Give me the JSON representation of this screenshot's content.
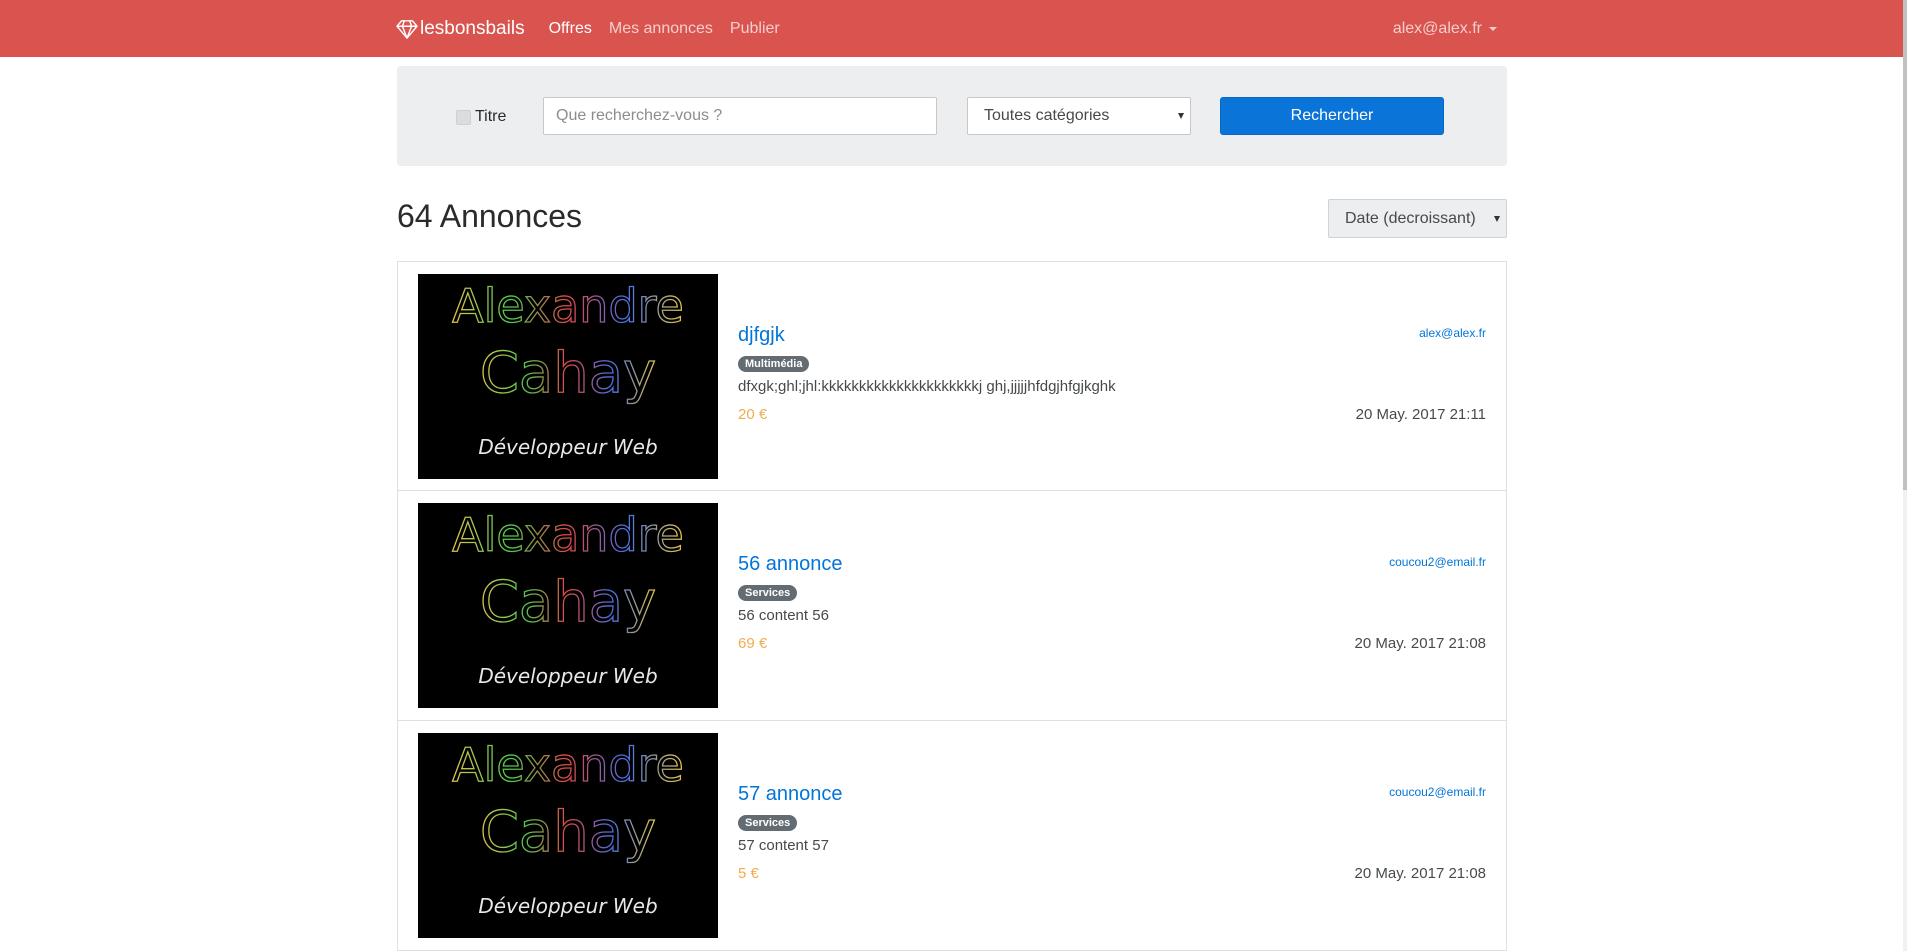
{
  "navbar": {
    "brand": "lesbonsbails",
    "links": [
      "Offres",
      "Mes annonces",
      "Publier"
    ],
    "user": "alex@alex.fr",
    "color": "#d9534f"
  },
  "search": {
    "checkbox_label": "Titre",
    "placeholder": "Que recherchez-vous ?",
    "category": "Toutes catégories",
    "button": "Rechercher"
  },
  "results": {
    "count_title": "64 Annonces",
    "sort": "Date (decroissant)"
  },
  "image_text": {
    "line1": "Alexandre",
    "line2": "Cahay",
    "line3": "Développeur Web"
  },
  "listings": [
    {
      "title": "djfgjk",
      "category": "Multimédia",
      "description": "dfxgk;ghl;jhl:kkkkkkkkkkkkkkkkkkkkkj ghj,jjjjjhfdgjhfgjkghk",
      "price": "20 €",
      "email": "alex@alex.fr",
      "date": "20 May. 2017 21:11"
    },
    {
      "title": "56 annonce",
      "category": "Services",
      "description": "56 content 56",
      "price": "69 €",
      "email": "coucou2@email.fr",
      "date": "20 May. 2017 21:08"
    },
    {
      "title": "57 annonce",
      "category": "Services",
      "description": "57 content 57",
      "price": "5 €",
      "email": "coucou2@email.fr",
      "date": "20 May. 2017 21:08"
    }
  ]
}
